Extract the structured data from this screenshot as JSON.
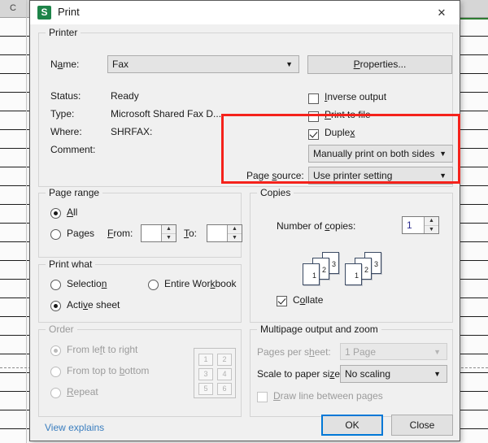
{
  "background": {
    "column_header": "C",
    "app": "spreadsheet"
  },
  "dialog": {
    "title": "Print",
    "icon": "S",
    "close_icon": "✕"
  },
  "printer": {
    "group_label": "Printer",
    "name_label": "Name:",
    "name_value": "Fax",
    "properties_button": "Properties...",
    "status_label": "Status:",
    "status_value": "Ready",
    "type_label": "Type:",
    "type_value": "Microsoft Shared Fax D...",
    "where_label": "Where:",
    "where_value": "SHRFAX:",
    "comment_label": "Comment:",
    "comment_value": "",
    "inverse_output": "Inverse output",
    "print_to_file": "Print to file",
    "duplex": "Duplex",
    "duplex_mode_value": "Manually print on both sides",
    "page_source_label": "Page source:",
    "page_source_value": "Use printer setting"
  },
  "page_range": {
    "group_label": "Page range",
    "all": "All",
    "pages": "Pages",
    "from_label": "From:",
    "from_value": "",
    "to_label": "To:",
    "to_value": ""
  },
  "copies": {
    "group_label": "Copies",
    "number_label": "Number of copies:",
    "number_value": "1",
    "collate": "Collate",
    "page_numbers": [
      "1",
      "2",
      "3"
    ]
  },
  "print_what": {
    "group_label": "Print what",
    "selection": "Selection",
    "entire_workbook": "Entire Workbook",
    "active_sheet": "Active sheet"
  },
  "order": {
    "group_label": "Order",
    "left_to_right": "From left to right",
    "top_to_bottom": "From top to bottom",
    "repeat": "Repeat",
    "preview_cells": [
      "1",
      "2",
      "3",
      "4",
      "5",
      "6"
    ]
  },
  "multipage": {
    "group_label": "Multipage output and zoom",
    "pages_per_sheet_label": "Pages per sheet:",
    "pages_per_sheet_value": "1 Page",
    "scale_label": "Scale to paper size:",
    "scale_value": "No scaling",
    "draw_line": "Draw line between pages"
  },
  "footer": {
    "view_explains": "View explains",
    "ok": "OK",
    "close": "Close"
  },
  "annotation": {
    "color": "#f5221b"
  },
  "glyphs": {
    "arrow_down": "▼",
    "arrow_up_small": "▲",
    "arrow_down_small": "▼"
  }
}
